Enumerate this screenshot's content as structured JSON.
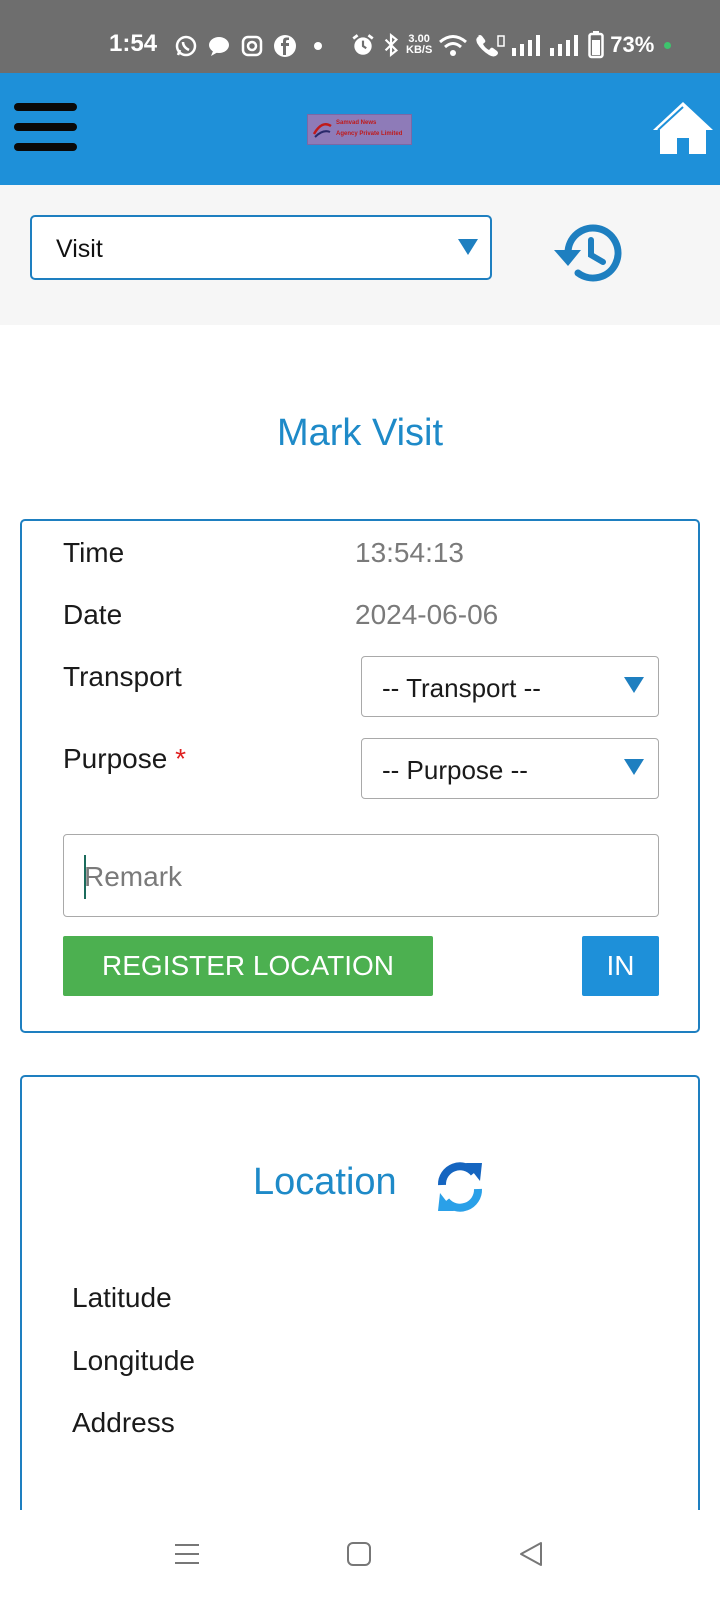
{
  "status_bar": {
    "time": "1:54",
    "speed_value": "3.00",
    "speed_unit": "KB/S",
    "battery": "73%",
    "icons": [
      "whatsapp-icon",
      "chat-icon",
      "instagram-icon",
      "facebook-icon",
      "dot-icon",
      "alarm-icon",
      "bluetooth-icon",
      "wifi-icon",
      "wifi-calling-icon",
      "signal-icon",
      "signal-icon",
      "battery-icon"
    ]
  },
  "app_bar": {
    "logo_line1": "Samvad News",
    "logo_line2": "Agency Private Limited",
    "colors": {
      "bar": "#1e90d9"
    }
  },
  "top_controls": {
    "mode_select_value": "Visit"
  },
  "page_title": "Mark Visit",
  "visit_form": {
    "time_label": "Time",
    "time_value": "13:54:13",
    "date_label": "Date",
    "date_value": "2024-06-06",
    "transport_label": "Transport",
    "transport_select": "-- Transport --",
    "purpose_label": "Purpose",
    "purpose_required": "*",
    "purpose_select": "-- Purpose --",
    "remark_placeholder": "Remark",
    "register_button": "REGISTER LOCATION",
    "in_button": "IN",
    "colors": {
      "register": "#4cb050",
      "in": "#1e90d9",
      "required": "#e02020"
    }
  },
  "location_card": {
    "title": "Location",
    "latitude_label": "Latitude",
    "longitude_label": "Longitude",
    "address_label": "Address"
  },
  "nav_bar": {
    "icons": [
      "recent-apps-icon",
      "home-icon",
      "back-icon"
    ]
  }
}
